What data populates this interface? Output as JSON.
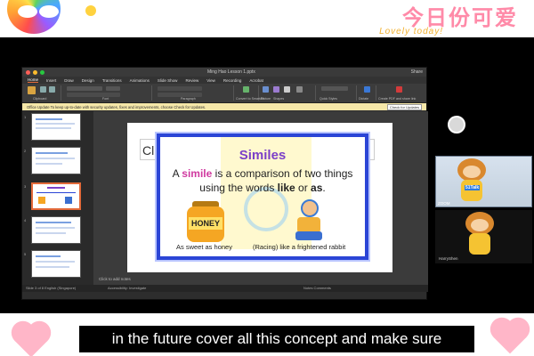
{
  "overlay": {
    "headline_cn": "今日份可爱",
    "headline_en": "Lovely today!"
  },
  "window": {
    "title": "Ming Hao Lesson 1.pptx",
    "share_label": "Share",
    "menu": [
      "Home",
      "Insert",
      "Draw",
      "Design",
      "Transitions",
      "Animations",
      "Slide Show",
      "Review",
      "View",
      "Recording",
      "Acrobat"
    ],
    "ribbon_groups": [
      "Clipboard",
      "Font",
      "Paragraph",
      "Convert to SmartArt",
      "Picture",
      "Shapes",
      "Text Box",
      "Arrange",
      "Quick Styles",
      "Dictate",
      "Create PDF and share link"
    ],
    "update_message": "Office Update  To keep up-to-date with security updates, fixes and improvements, choose Check for Updates.",
    "update_button": "Check for Updates",
    "slide_title_partial": "Cl",
    "notes_placeholder": "Click to add notes",
    "status_left": "Slide 3 of 8    English (Singapore)",
    "status_mid": "Accessibility: Investigate",
    "status_right": "Notes    Comments"
  },
  "lesson": {
    "heading": "Similes",
    "line1_prefix": "A",
    "line1_highlight": "simile",
    "line1_suffix": "is a comparison of two things",
    "line2_prefix": "using the words",
    "line2_like": "like",
    "line2_mid": "or",
    "line2_as": "as",
    "line2_end": ".",
    "jar_label": "HONEY",
    "caption_left": "As sweet as honey",
    "caption_right": "(Racing) like a frightened rabbit"
  },
  "webcam": {
    "tile1_name": "ZOOM",
    "mascot_badge": "51Talk",
    "tile2_name": "HarryShen"
  },
  "subtitle": "in the future cover all this concept and make sure",
  "colors": {
    "accent_border": "#2b45d6",
    "heading_purple": "#7b3fc8",
    "highlight_pink": "#d03aa0",
    "brand_orange": "#e36a3a"
  }
}
